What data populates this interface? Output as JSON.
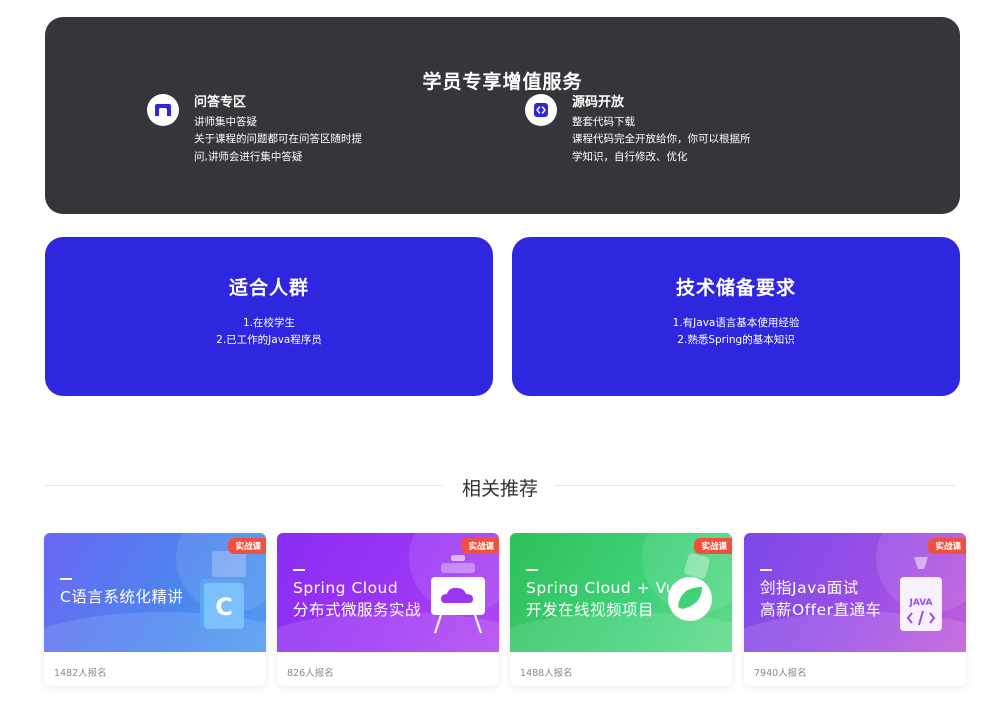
{
  "services": {
    "title": "学员专享增值服务",
    "items": [
      {
        "name": "问答专区",
        "subtitle": "讲师集中答疑",
        "desc_lines": [
          "关于课程的问题都可在问答区随时提",
          "问,讲师会进行集中答疑"
        ],
        "icon": "chat-bubble-icon"
      },
      {
        "name": "源码开放",
        "subtitle": "整套代码下载",
        "desc_lines": [
          "课程代码完全开放给你，你可以根据所",
          "学知识，自行修改、优化"
        ],
        "icon": "code-icon"
      }
    ]
  },
  "audience": {
    "title": "适合人群",
    "lines": [
      "1.在校学生",
      "2.已工作的Java程序员"
    ]
  },
  "requirements": {
    "title": "技术储备要求",
    "lines": [
      "1.有Java语言基本使用经验",
      "2.熟悉Spring的基本知识"
    ]
  },
  "related": {
    "heading": "相关推荐",
    "courses": [
      {
        "line1": "C语言系统化精讲",
        "line2": "",
        "tag": "实战课",
        "enrolled": "1482人报名"
      },
      {
        "line1": "Spring Cloud",
        "line2": "分布式微服务实战",
        "tag": "实战课",
        "enrolled": "826人报名"
      },
      {
        "line1": "Spring Cloud + Vue",
        "line2": "开发在线视频项目",
        "tag": "实战课",
        "enrolled": "1488人报名"
      },
      {
        "line1": "剑指Java面试",
        "line2": "高薪Offer直通车",
        "tag": "实战课",
        "enrolled": "7940人报名"
      }
    ]
  },
  "colors": {
    "dark_panel": "#343639",
    "blue_card": "#2f27e0",
    "tag": "#f0513f"
  }
}
